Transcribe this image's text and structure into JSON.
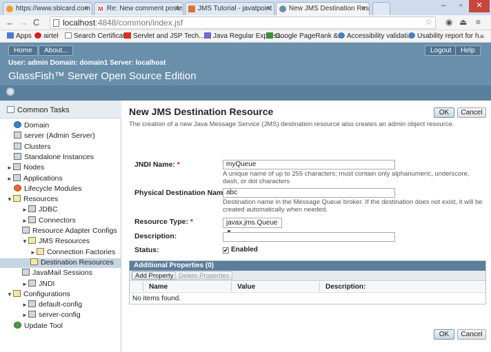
{
  "browser": {
    "tabs": [
      {
        "label": "https://www.sbicard.com",
        "icon": "globe-icon",
        "color": "#f29b2a"
      },
      {
        "label": "Re: New comment posted",
        "icon": "gmail-icon",
        "color": "#d93025"
      },
      {
        "label": "JMS Tutorial - javatpoint",
        "icon": "javatpoint-icon",
        "color": "#e0712e"
      },
      {
        "label": "New JMS Destination Reso",
        "icon": "glassfish-icon",
        "color": "#6a8fab"
      }
    ],
    "window_controls": [
      "–",
      "▫",
      "✕"
    ],
    "url_host": "localhost",
    "url_rest": ":4848/common/index.jsf",
    "bookmarks": [
      "Apps",
      "airtel",
      "Search Certificate",
      "Servlet and JSP Tech...",
      "Java Regular Express...",
      "Google PageRank &...",
      "Accessibility validati...",
      "Usability report for h..."
    ],
    "more_bookmarks": "»"
  },
  "header": {
    "home": "Home",
    "about": "About...",
    "logout": "Logout",
    "help": "Help",
    "user_line": "User: admin   Domain: domain1   Server: localhost",
    "title": "GlassFish™ Server Open Source Edition"
  },
  "sidebar": {
    "title": "Common Tasks",
    "items": [
      {
        "label": "Domain",
        "arrow": "",
        "icon": "globe"
      },
      {
        "label": "server (Admin Server)",
        "arrow": "",
        "icon": "pc"
      },
      {
        "label": "Clusters",
        "arrow": "",
        "icon": "pc"
      },
      {
        "label": "Standalone Instances",
        "arrow": "",
        "icon": "pc"
      },
      {
        "label": "Nodes",
        "arrow": "►",
        "icon": "pc"
      },
      {
        "label": "Applications",
        "arrow": "►",
        "icon": "pc"
      },
      {
        "label": "Lifecycle Modules",
        "arrow": "",
        "icon": "mod"
      },
      {
        "label": "Resources",
        "arrow": "▼",
        "icon": "folder"
      },
      {
        "label": "JDBC",
        "arrow": "►",
        "icon": "pc"
      },
      {
        "label": "Connectors",
        "arrow": "►",
        "icon": "pc"
      },
      {
        "label": "Resource Adapter Configs",
        "arrow": "",
        "icon": "pc"
      },
      {
        "label": "JMS Resources",
        "arrow": "▼",
        "icon": "folder"
      },
      {
        "label": "Connection Factories",
        "arrow": "►",
        "icon": "folder"
      },
      {
        "label": "Destination Resources",
        "arrow": "",
        "icon": "folder",
        "selected": true
      },
      {
        "label": "JavaMail Sessions",
        "arrow": "",
        "icon": "pc"
      },
      {
        "label": "JNDI",
        "arrow": "►",
        "icon": "pc"
      },
      {
        "label": "Configurations",
        "arrow": "▼",
        "icon": "folder"
      },
      {
        "label": "default-config",
        "arrow": "►",
        "icon": "pc"
      },
      {
        "label": "server-config",
        "arrow": "►",
        "icon": "pc"
      },
      {
        "label": "Update Tool",
        "arrow": "",
        "icon": "upd"
      }
    ]
  },
  "main": {
    "title": "New JMS Destination Resource",
    "help": "The creation of a new Java Message Service (JMS) destination resource also creates an admin object resource.",
    "ok": "OK",
    "cancel": "Cancel",
    "jndi_label": "JNDI Name:",
    "jndi_value": "myQueue",
    "jndi_help": "A unique name of up to 255 characters; must contain only alphanumeric, underscore, dash, or dot characters",
    "phys_label": "Physical Destination Name",
    "phys_value": "abc",
    "phys_help": "Destination name in the Message Queue broker. If the destination does not exist, it will be created automatically when needed.",
    "type_label": "Resource Type:",
    "type_value": "javax.jms.Queue",
    "desc_label": "Description:",
    "desc_value": "",
    "status_label": "Status:",
    "status_value": "Enabled",
    "required_mark": "*",
    "props_title": "Additional Properties (0)",
    "add_property": "Add Property",
    "delete_properties": "Delete Properties",
    "col_name": "Name",
    "col_value": "Value",
    "col_desc": "Description:",
    "empty": "No items found."
  }
}
